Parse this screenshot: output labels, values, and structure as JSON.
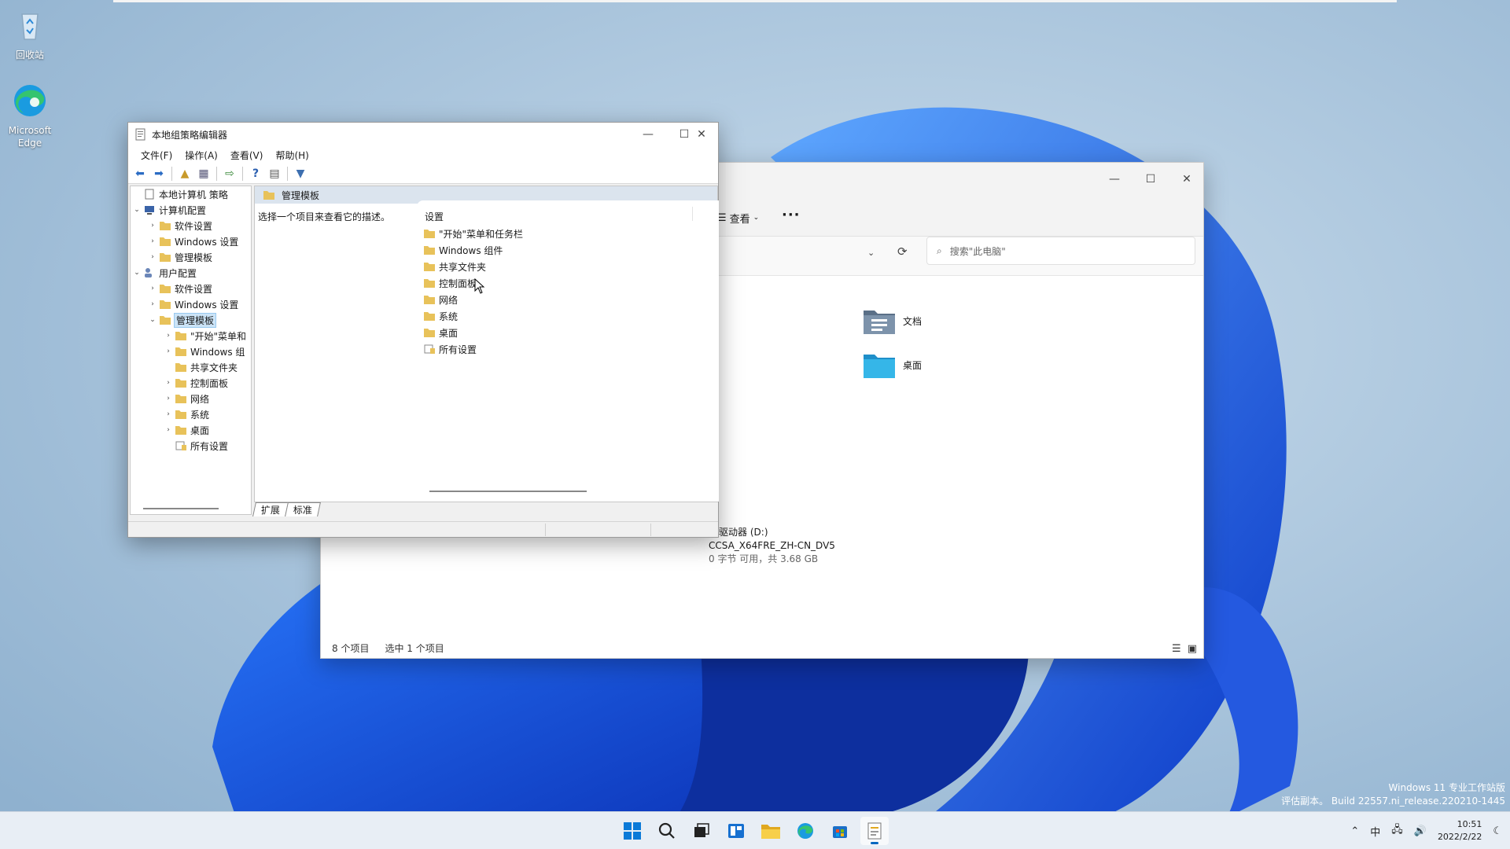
{
  "desktop": {
    "icons": [
      {
        "label": "回收站"
      },
      {
        "label": "Microsoft Edge"
      }
    ],
    "watermark": {
      "line1": "Windows 11 专业工作站版",
      "line2": "评估副本。 Build 22557.ni_release.220210-1445"
    }
  },
  "explorer": {
    "view_label": "查看",
    "more_label": "···",
    "search_placeholder": "搜索\"此电脑\"",
    "folders": [
      {
        "label": "文档"
      },
      {
        "label": "桌面"
      }
    ],
    "drive": {
      "name": "D 驱动器 (D:)",
      "volume": "CCSA_X64FRE_ZH-CN_DV5",
      "space": "0 字节 可用，共 3.68 GB"
    },
    "status": {
      "count": "8 个项目",
      "selected": "选中 1 个项目"
    }
  },
  "gpedit": {
    "title": "本地组策略编辑器",
    "menu": [
      "文件(F)",
      "操作(A)",
      "查看(V)",
      "帮助(H)"
    ],
    "tree": [
      {
        "label": "本地计算机 策略"
      },
      {
        "label": "计算机配置"
      },
      {
        "label": "软件设置"
      },
      {
        "label": "Windows 设置"
      },
      {
        "label": "管理模板"
      },
      {
        "label": "用户配置"
      },
      {
        "label": "软件设置"
      },
      {
        "label": "Windows 设置"
      },
      {
        "label": "管理模板"
      },
      {
        "label": "\"开始\"菜单和"
      },
      {
        "label": "Windows 组"
      },
      {
        "label": "共享文件夹"
      },
      {
        "label": "控制面板"
      },
      {
        "label": "网络"
      },
      {
        "label": "系统"
      },
      {
        "label": "桌面"
      },
      {
        "label": "所有设置"
      }
    ],
    "pane_header": "管理模板",
    "pane_desc": "选择一个项目来查看它的描述。",
    "list_header": "设置",
    "list_items": [
      {
        "label": "\"开始\"菜单和任务栏"
      },
      {
        "label": "Windows 组件"
      },
      {
        "label": "共享文件夹"
      },
      {
        "label": "控制面板"
      },
      {
        "label": "网络"
      },
      {
        "label": "系统"
      },
      {
        "label": "桌面"
      },
      {
        "label": "所有设置"
      }
    ],
    "tabs": [
      "扩展",
      "标准"
    ]
  },
  "taskbar": {
    "tray": {
      "ime": "中",
      "time": "10:51",
      "date": "2022/2/22"
    }
  },
  "colors": {
    "accent": "#0067c0",
    "folder": "#e8c25a",
    "selection": "#cce4f7"
  }
}
